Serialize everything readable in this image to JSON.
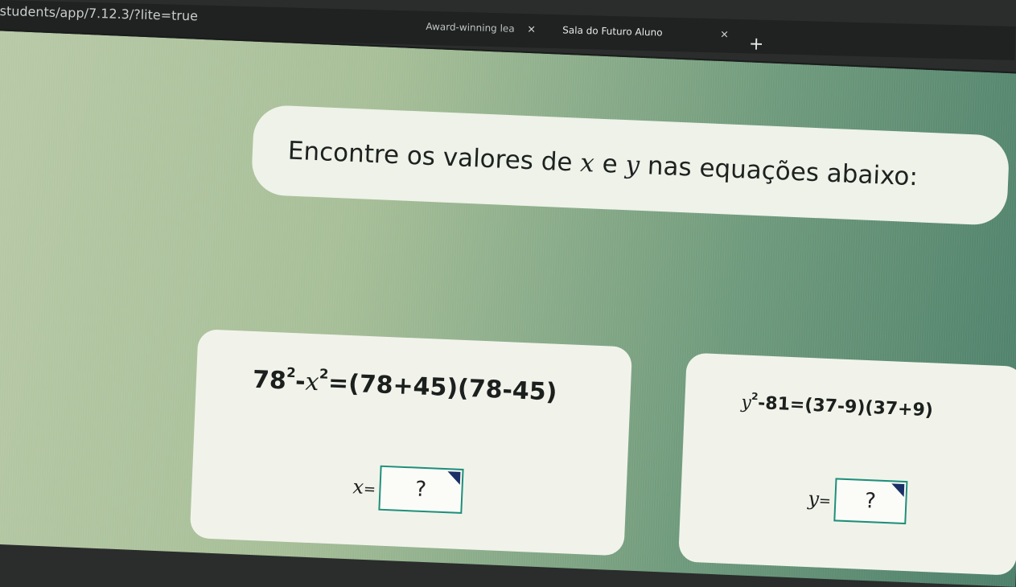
{
  "browser": {
    "url": "students/app/7.12.3/?lite=true",
    "tabs": [
      {
        "title": "Award-winning lea",
        "close": "×"
      },
      {
        "title": "Sala do Futuro Aluno",
        "close": "×"
      }
    ],
    "new_tab": "+"
  },
  "exercise": {
    "instruction_pre": "Encontre os valores de ",
    "var_x": "x",
    "instruction_mid": " e ",
    "var_y": "y",
    "instruction_post": " nas equações abaixo:",
    "left": {
      "eq_a": "78",
      "eq_exp1": "2",
      "eq_minus": "-",
      "eq_var": "x",
      "eq_exp2": "2",
      "eq_rhs": "=(78+45)(78-45)",
      "answer_var": "x",
      "answer_eq": "=",
      "answer_value": "?"
    },
    "right": {
      "eq_var": "y",
      "eq_exp": "2",
      "eq_rest": "-81=(37-9)(37+9)",
      "answer_var": "y",
      "answer_eq": "=",
      "answer_value": "?"
    }
  },
  "colors": {
    "answer_border": "#1e8f7a",
    "dropdown_indicator": "#1a2f66",
    "card_bg": "#f1f3ea"
  }
}
